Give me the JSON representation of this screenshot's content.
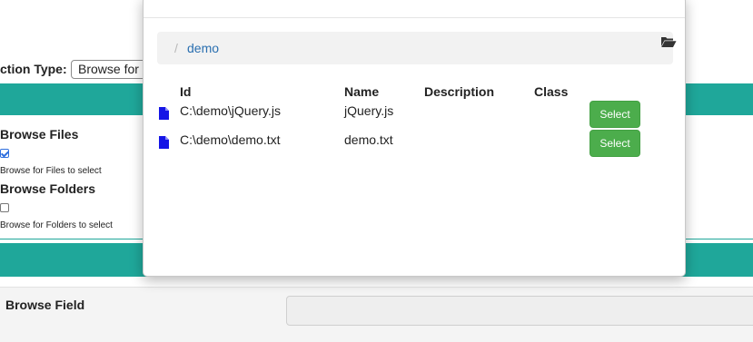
{
  "background": {
    "action_type_label": "ction Type:",
    "action_type_value": "Browse for",
    "browse_files_heading": "Browse Files",
    "browse_files_checked": true,
    "browse_files_help": "Browse for Files to select",
    "browse_folders_heading": "Browse Folders",
    "browse_folders_checked": false,
    "browse_folders_help": "Browse for Folders to select",
    "browse_field_label": "Browse Field",
    "colors": {
      "teal": "#1fa79a"
    }
  },
  "modal": {
    "breadcrumb": {
      "separator": "/",
      "current": "demo"
    },
    "table": {
      "headers": {
        "id": "Id",
        "name": "Name",
        "description": "Description",
        "class": "Class"
      },
      "rows": [
        {
          "icon": "file-icon",
          "id": "C:\\demo\\jQuery.js",
          "name": "jQuery.js",
          "description": "",
          "class": "",
          "action": "Select"
        },
        {
          "icon": "file-icon",
          "id": "C:\\demo\\demo.txt",
          "name": "demo.txt",
          "description": "",
          "class": "",
          "action": "Select"
        }
      ]
    },
    "colors": {
      "select_button": "#4cad4c",
      "link": "#2a6fb0",
      "file_icon": "#1515e6"
    }
  }
}
